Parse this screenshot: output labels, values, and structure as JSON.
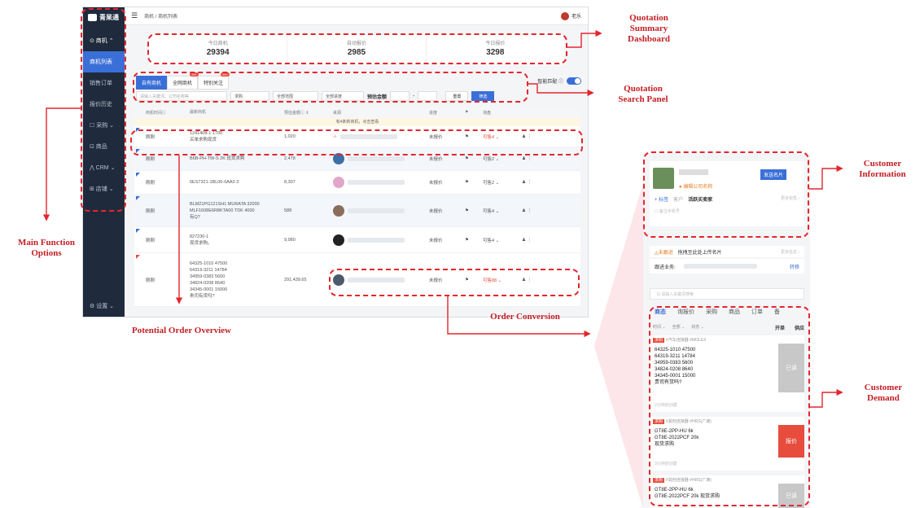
{
  "app": {
    "brand": "青杲通",
    "breadcrumb": "商机 / 商机列表",
    "user_name": "老乐"
  },
  "sidebar": {
    "items": [
      {
        "label": "⊙ 商机 ⌃",
        "state": "head"
      },
      {
        "label": "商机列表",
        "state": "active"
      },
      {
        "label": "销售订单",
        "state": "normal"
      },
      {
        "label": "报价历史",
        "state": "normal"
      },
      {
        "label": "☐ 采购 ⌄",
        "state": "normal"
      },
      {
        "label": "⊡ 商品",
        "state": "normal"
      },
      {
        "label": "⋀ CRM ⌄",
        "state": "normal"
      },
      {
        "label": "⊞ 店铺 ⌄",
        "state": "normal"
      }
    ],
    "settings": "⚙ 设置 ⌄"
  },
  "stats": [
    {
      "label": "今日商机",
      "value": "29394"
    },
    {
      "label": "自动报价",
      "value": "2985"
    },
    {
      "label": "今日报价",
      "value": "3298"
    }
  ],
  "tabs": [
    {
      "label": "自有商机",
      "badge": ""
    },
    {
      "label": "全网商机",
      "badge": "99+"
    },
    {
      "label": "特别关注",
      "badge": "99+"
    }
  ],
  "smart_match": "智能匹配 ⓘ",
  "filters": {
    "search_placeholder": "请输入关键词、公司名称等",
    "type": "求购",
    "scope": "全部范围",
    "progress": "全部进度",
    "amount_label": "预估金额",
    "dash": "-",
    "reset": "重置",
    "submit": "筛选"
  },
  "table": {
    "headers": [
      "商机时间ⓘ",
      "最新商机",
      "预估金额ⓘ ⇕",
      "来源",
      "进度",
      "⚑",
      "询盘"
    ],
    "notice": "有4条新商机，点击查看",
    "rows": [
      {
        "time": "刚刚",
        "content": "1241408-1 1700\n买单求购现货",
        "amount": "1,020",
        "progress": "未报价",
        "inquiry": "可售4 ⌄",
        "flag": "blue"
      },
      {
        "time": "刚刚",
        "content": "B6B-PH-TW-S 2K 现货求购",
        "amount": "2,478",
        "progress": "未报价",
        "inquiry": "可售2 ⌄",
        "flag": "blue"
      },
      {
        "time": "刚刚",
        "content": "6ES7321-1BL00-0AA0 3",
        "amount": "8,307",
        "progress": "未报价",
        "inquiry": "可售2 ⌄",
        "flag": "blue"
      },
      {
        "time": "刚刚",
        "content": "BLM21PG121SH1 MURATA 32000\nMLF1608E6R8KTA00 TDK 4000\n有Q?",
        "amount": "588",
        "progress": "未报价",
        "inquiry": "可售4 ⌄",
        "flag": "blue"
      },
      {
        "time": "刚刚",
        "content": "827230-1\n现货求购。",
        "amount": "9,980",
        "progress": "未报价",
        "inquiry": "可售4 ⌄",
        "flag": "blue"
      },
      {
        "time": "刚刚",
        "content": "64325-1010 47500\n64319-3211 14784\n34959-0383 5600\n34824-0208 8640\n34345-0001 15000\n贵司有货吗?",
        "amount": "291,439.65",
        "progress": "未报价",
        "inquiry": "可售88 ⌄",
        "flag": "red"
      }
    ]
  },
  "phone": {
    "send_card": "发送名片",
    "edit_company": "编辑公司名称",
    "add_tag": "+ 标签",
    "customer_tag": "客户",
    "active_buyer": "活跃买卖家",
    "more_tags": "更多标签 ›",
    "note_placeholder": "☐ 备注手机号",
    "not_followed": "◬未跟进",
    "drag_card": "拖拽至此处上传名片",
    "more_info": "更多信息 ›",
    "owner_label": "跟进业务:",
    "transfer": "转移",
    "search_placeholder": "Q 请输入关键词搜索",
    "tabs": [
      "商态",
      "询报价",
      "采购",
      "商品",
      "订单",
      "备"
    ],
    "filter_time": "时间 ⌄",
    "filter_all": "全部 ⌄",
    "filter_status": "状态 ⌄",
    "open_order": "开单",
    "supply": "供应",
    "cards": [
      {
        "tag": "求购",
        "cats": "#汽车连接器 #MOLEX",
        "body": "64325-1010 47500\n64319-3211 14784\n34959-0383 5600\n34824-0208 8640\n34345-0001 15000\n贵司有货吗?",
        "button": "已读",
        "time": "2分钟前创建"
      },
      {
        "tag": "求购",
        "cats": "#其他连接器 #HRS(广濑)",
        "body": "GT8E-2PP-HU 6k\nGT8E-2022PCF 20k\n现货求购",
        "button": "报价",
        "time": "3分钟前创建"
      },
      {
        "tag": "求购",
        "cats": "#其他连接器 #HRS(广濑)",
        "body": "GT8E-2PP-HU 6k\nGT8E-2022PCF 20k 现货求购",
        "button": "已读",
        "time": ""
      }
    ]
  },
  "annotations": {
    "summary": "Quotation\nSummary\nDashboard",
    "search": "Quotation\nSearch Panel",
    "main_options": "Main Function\nOptions",
    "potential": "Potential Order Overview",
    "conversion": "Order Conversion",
    "customer_info": "Customer\nInformation",
    "customer_demand": "Customer\nDemand"
  },
  "colors": {
    "annotation_red": "#e3262e",
    "sidebar_bg": "#1f2b3d",
    "primary_blue": "#3a6fd8"
  }
}
